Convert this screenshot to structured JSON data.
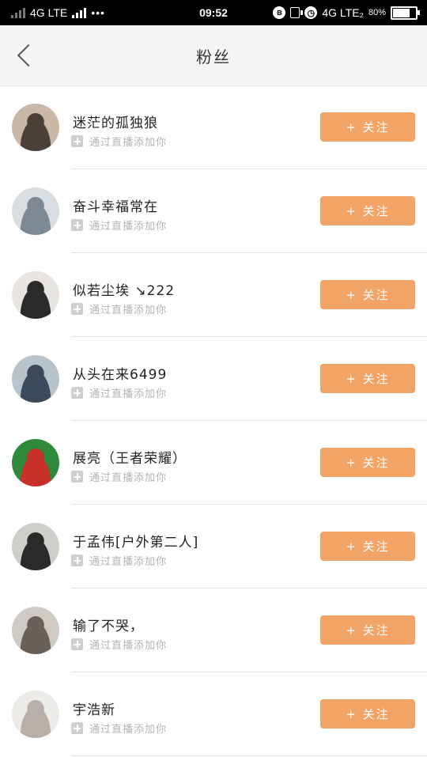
{
  "status_bar": {
    "carrier_left": "4G LTE",
    "dots": "•••",
    "time": "09:52",
    "carrier_right": "4G LTE₂",
    "battery": "80%",
    "battery_level": 0.8
  },
  "header": {
    "title": "粉丝"
  },
  "fans": [
    {
      "name": "迷茫的孤独狼",
      "source": "通过直播添加你",
      "follow_label": "+ 关注",
      "avatar_colors": [
        "#c9b8a8",
        "#4a4038"
      ]
    },
    {
      "name": "奋斗幸福常在",
      "source": "通过直播添加你",
      "follow_label": "+ 关注",
      "avatar_colors": [
        "#d8dde2",
        "#7c8892"
      ]
    },
    {
      "name": "似若尘埃 ↘222",
      "source": "通过直播添加你",
      "follow_label": "+ 关注",
      "avatar_colors": [
        "#e8e4e0",
        "#2a2a2a"
      ]
    },
    {
      "name": "从头在来6499",
      "source": "通过直播添加你",
      "follow_label": "+ 关注",
      "avatar_colors": [
        "#b8c4cc",
        "#3a4a5a"
      ]
    },
    {
      "name": "展亮（王者荣耀）",
      "source": "通过直播添加你",
      "follow_label": "+ 关注",
      "avatar_colors": [
        "#2e8a3a",
        "#c8302a"
      ]
    },
    {
      "name": "于孟伟[户外第二人]",
      "source": "通过直播添加你",
      "follow_label": "+ 关注",
      "avatar_colors": [
        "#d0cec8",
        "#2a2a2a"
      ]
    },
    {
      "name": "输了不哭，",
      "source": "通过直播添加你",
      "follow_label": "+ 关注",
      "avatar_colors": [
        "#cfcac4",
        "#6a6058"
      ]
    },
    {
      "name": "宇浩新",
      "source": "通过直播添加你",
      "follow_label": "+ 关注",
      "avatar_colors": [
        "#ecebe8",
        "#b8b0a8"
      ]
    }
  ],
  "colors": {
    "accent": "#f2a366",
    "nav_bg": "#f5f5f5"
  }
}
